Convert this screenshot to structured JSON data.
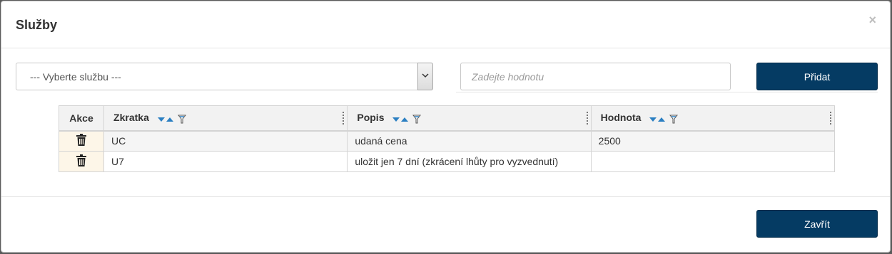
{
  "dialog": {
    "title": "Služby",
    "close_symbol": "×"
  },
  "form": {
    "service_select": {
      "selected": "--- Vyberte službu ---"
    },
    "value_input": {
      "placeholder": "Zadejte hodnotu",
      "value": ""
    },
    "add_label": "Přidat"
  },
  "table": {
    "columns": {
      "actions": "Akce",
      "code": "Zkratka",
      "description": "Popis",
      "value": "Hodnota"
    },
    "rows": [
      {
        "code": "UC",
        "description": "udaná cena",
        "value": "2500"
      },
      {
        "code": "U7",
        "description": "uložit jen 7 dní (zkrácení lhůty pro vyzvednutí)",
        "value": ""
      }
    ]
  },
  "footer": {
    "close_label": "Zavřít"
  },
  "colors": {
    "primary": "#053b63",
    "action_cell": "#fdf6e8",
    "sort_arrow": "#2b7fc2"
  },
  "icons": {
    "sort": "sort-arrows-icon",
    "filter": "filter-icon",
    "delete": "trash-icon",
    "dropdown": "chevron-down-icon",
    "close": "close-icon"
  }
}
